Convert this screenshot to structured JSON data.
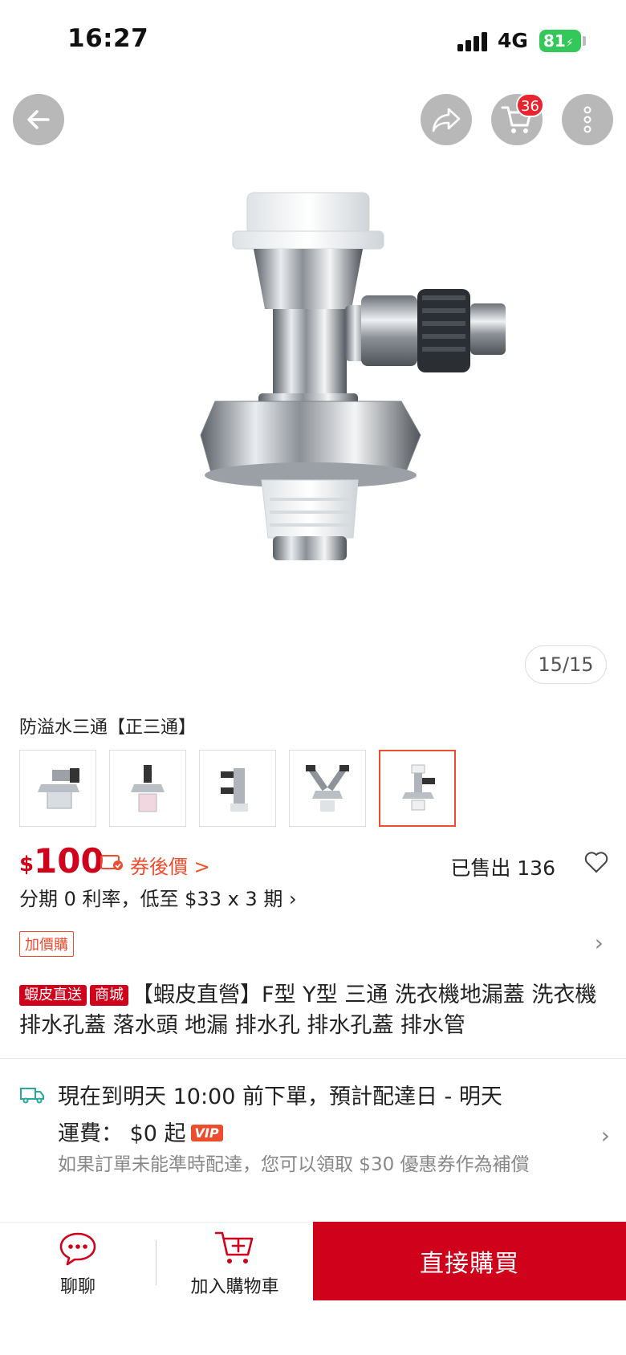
{
  "status_bar": {
    "time": "16:27",
    "network": "4G",
    "battery": "81"
  },
  "nav": {
    "cart_count": "36"
  },
  "gallery": {
    "page_indicator": "15/15",
    "variant_label": "防溢水三通【正三通】",
    "selected_thumb": 5,
    "thumb_count": 5
  },
  "price": {
    "currency": "$",
    "amount": "100",
    "coupon_text": "券後價 >",
    "sold": "已售出 136"
  },
  "installment": "分期 0 利率，低至 $33 x 3 期 ›",
  "addon": {
    "label": "加價購"
  },
  "title": {
    "tag_direct": "蝦皮直送",
    "tag_mall": "商城",
    "text": "【蝦皮直營】F型 Y型 三通 洗衣機地漏蓋 洗衣機排水孔蓋 落水頭 地漏 排水孔 排水孔蓋 排水管"
  },
  "shipping": {
    "line1": "現在到明天 10:00 前下單，預計配達日 - 明天",
    "line2": "運費： $0 起",
    "vip": "VIP",
    "note": "如果訂單未能準時配達，您可以領取 $30 優惠券作為補償"
  },
  "bottom_bar": {
    "chat": "聊聊",
    "add_to_cart": "加入購物車",
    "buy_now": "直接購買"
  },
  "colors": {
    "primary": "#d0011b",
    "accent": "#ee4d2d",
    "battery": "#34c759"
  }
}
